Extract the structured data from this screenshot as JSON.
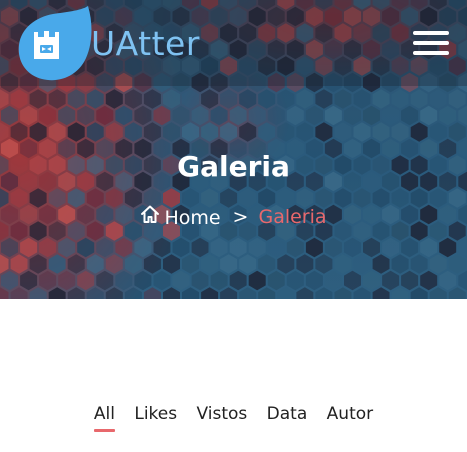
{
  "header": {
    "brand_name": "UAtter",
    "logo_icon": "castle-drop-logo",
    "menu_icon": "hamburger-menu-icon"
  },
  "hero": {
    "title": "Galeria",
    "breadcrumb": {
      "home_icon": "home-icon",
      "home_label": "Home",
      "separator": ">",
      "current_label": "Galeria"
    }
  },
  "filters": {
    "items": [
      {
        "label": "All",
        "active": true
      },
      {
        "label": "Likes",
        "active": false
      },
      {
        "label": "Vistos",
        "active": false
      },
      {
        "label": "Data",
        "active": false
      },
      {
        "label": "Autor",
        "active": false
      }
    ]
  },
  "colors": {
    "accent": "#e8686c",
    "brand_text": "#7fc2f2",
    "hero_blue": "#2a5a7c",
    "hero_red": "#a83434"
  }
}
